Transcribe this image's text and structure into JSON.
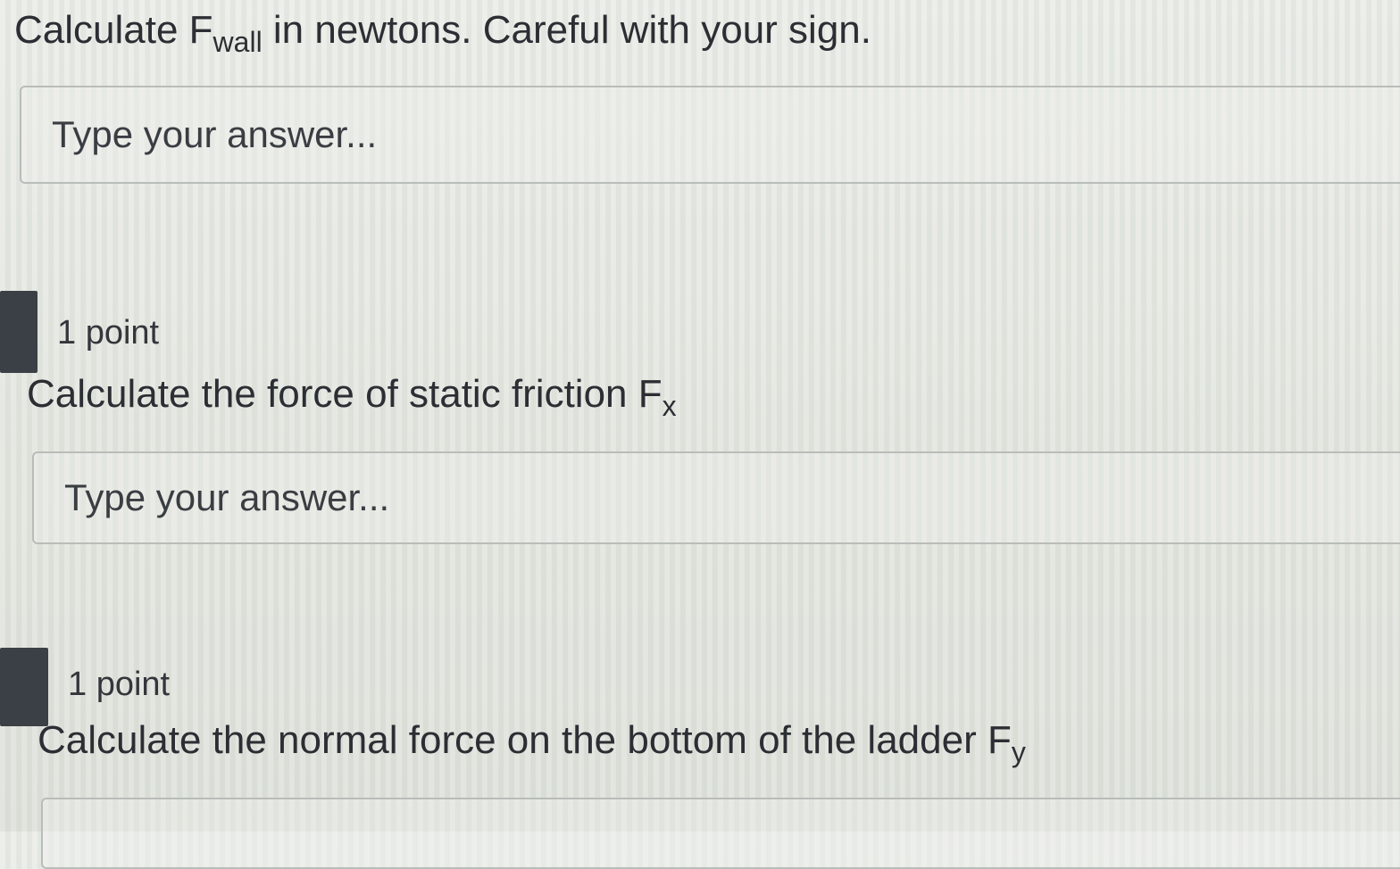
{
  "questions": [
    {
      "text_main": "Calculate F",
      "text_sub": "wall",
      "text_tail": " in newtons. Careful with your sign.",
      "answer_placeholder": "Type your answer..."
    },
    {
      "points": "1 point",
      "text_main": "Calculate the force of static friction F",
      "text_sub": "x",
      "answer_placeholder": "Type your answer..."
    },
    {
      "points": "1 point",
      "text_main": "Calculate the normal force on the bottom of the ladder F",
      "text_sub": "y"
    }
  ]
}
